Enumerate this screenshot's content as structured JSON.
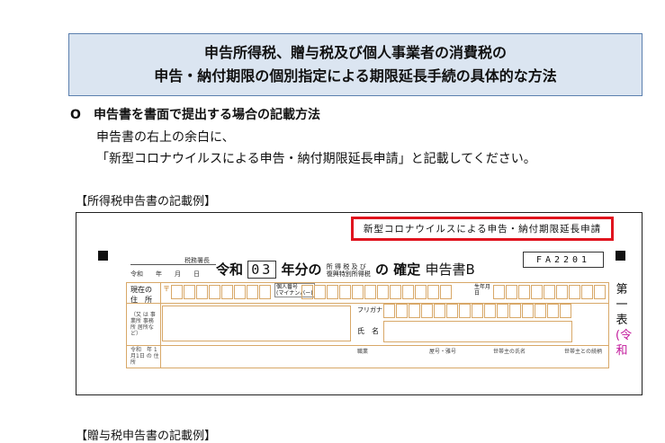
{
  "title": {
    "line1": "申告所得税、贈与税及び個人事業者の消費税の",
    "line2": "申告・納付期限の個別指定による期限延長手続の具体的な方法"
  },
  "section": {
    "mark": "O",
    "heading": "申告書を書面で提出する場合の記載方法",
    "body_line1": "申告書の右上の余白に、",
    "body_line2": "「新型コロナウイルスによる申告・納付期限延長申請」と記載してください。"
  },
  "example_label": "【所得税申告書の記載例】",
  "example_label_next": "【贈与税申告書の記載例】",
  "form": {
    "red_box_text": "新型コロナウイルスによる申告・納付期限延長申請",
    "tax_office": "税務署長",
    "date_line": "令和　　年　　月　　日",
    "reiwa": "令和",
    "year": "03",
    "year_suffix": "年分の",
    "small_stack_top": "所 得 税 及 び",
    "small_stack_bottom": "復興特別所得税",
    "no": "の",
    "kakutei": "確定",
    "return_name": "申告書B",
    "code": "FA2201",
    "current_address_1": "現在の",
    "current_address_2": "住　所",
    "or_line": "（又 は 事業所 事務所 居所など）",
    "reiwa_jan1": "令和　年 1月1日 の 住 所",
    "postal_mark": "〒",
    "personal_number_label": "個人番号",
    "my_number": "(マイナンバー)",
    "birth_label": "生年月日",
    "furigana": "フリガナ",
    "name_label": "氏　名",
    "occupation": "職業",
    "shop_name": "屋号・雅号",
    "head_name": "世帯主の氏名",
    "relation": "世帯主との続柄",
    "side_1": "第",
    "side_2": "一",
    "side_3": "表",
    "side_4": "(令",
    "side_5": "和"
  }
}
